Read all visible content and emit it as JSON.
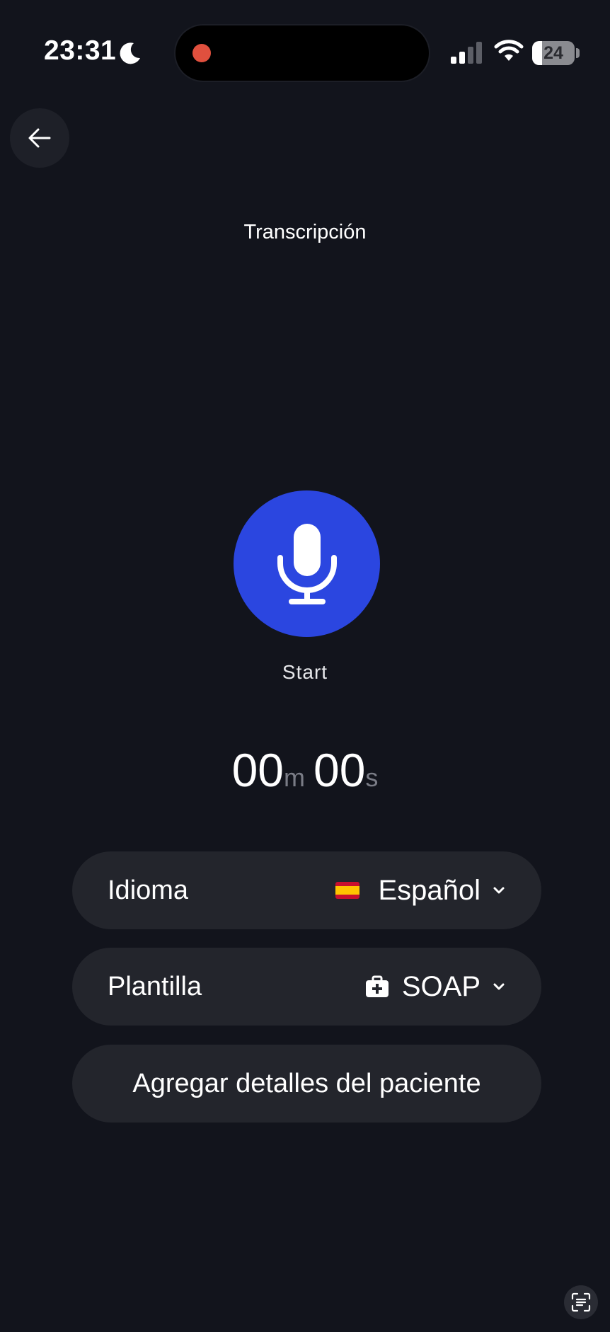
{
  "status_bar": {
    "time": "23:31",
    "battery_level": "24",
    "battery_fraction": 0.24,
    "icons": [
      "moon-icon",
      "signal-icon",
      "wifi-icon",
      "battery-icon"
    ]
  },
  "header": {
    "back_icon": "arrow-left-icon",
    "title": "Transcripción"
  },
  "recorder": {
    "mic_icon": "microphone-icon",
    "start_label": "Start",
    "timer": {
      "minutes": "00",
      "minutes_unit": "m",
      "seconds": "00",
      "seconds_unit": "s"
    }
  },
  "settings": {
    "language": {
      "label": "Idioma",
      "value": "Español",
      "icon": "spain-flag-icon"
    },
    "template": {
      "label": "Plantilla",
      "value": "SOAP",
      "icon": "medical-kit-icon"
    },
    "patient_details_label": "Agregar detalles del paciente"
  },
  "colors": {
    "background": "#12141c",
    "accent": "#2b46e0",
    "row_background": "#23252c",
    "recording_dot": "#e0503e"
  }
}
